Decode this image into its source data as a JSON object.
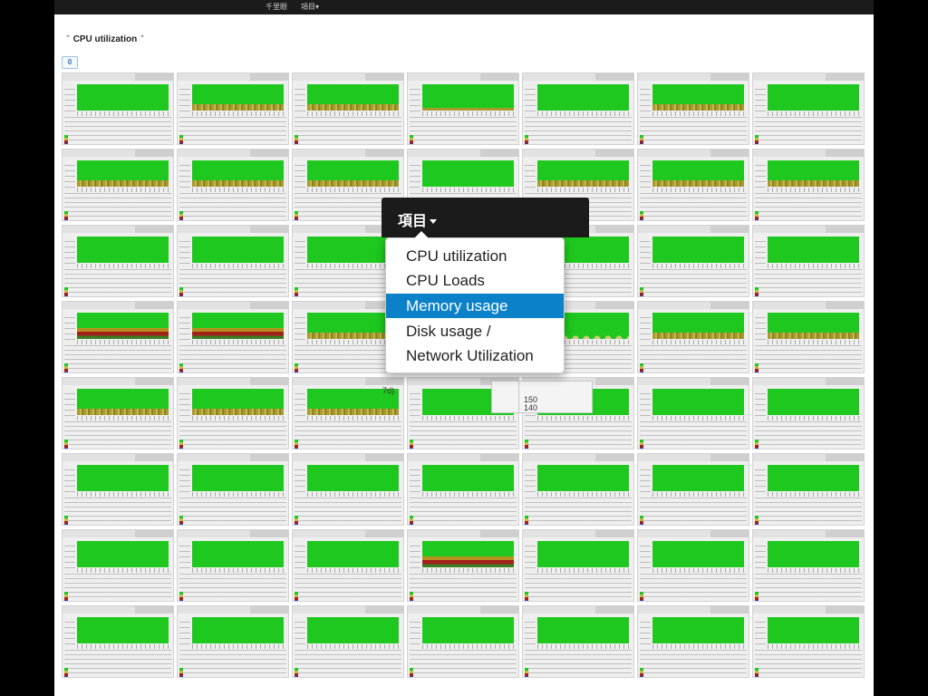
{
  "topbar": {
    "brand": "千里眼",
    "menu": "項目▾"
  },
  "page": {
    "title": "CPU utilization",
    "badge": "0"
  },
  "tile_style": [
    [
      "plain",
      "yellow",
      "yellow",
      "yellow-lo",
      "plain",
      "yellow",
      "plain"
    ],
    [
      "yellow",
      "yellow",
      "yellow",
      "plain",
      "yellow",
      "yellow",
      "yellow"
    ],
    [
      "plain",
      "plain",
      "plain",
      "plain",
      "plain",
      "plain",
      "plain"
    ],
    [
      "red",
      "red",
      "yellow",
      "plain",
      "dots",
      "yellow",
      "yellow"
    ],
    [
      "yellow",
      "yellow",
      "yellow",
      "plain",
      "plain",
      "plain",
      "plain"
    ],
    [
      "plain",
      "plain",
      "plain",
      "plain",
      "plain",
      "plain",
      "plain"
    ],
    [
      "plain",
      "plain",
      "plain",
      "red",
      "plain",
      "plain",
      "plain"
    ],
    [
      "plain",
      "plain",
      "plain",
      "plain",
      "plain",
      "plain",
      "plain"
    ]
  ],
  "overlay": {
    "dropdown_label": "項目",
    "items": [
      {
        "label": "CPU utilization",
        "active": false
      },
      {
        "label": "CPU Loads",
        "active": false
      },
      {
        "label": "Memory usage",
        "active": true
      },
      {
        "label": "Disk usage /",
        "active": false
      },
      {
        "label": "Network Utilization",
        "active": false
      }
    ],
    "background_fragments": {
      "period": "7d)",
      "axis_a": "150",
      "axis_b": "140"
    }
  },
  "colors": {
    "active": "#0a81c9",
    "graph": "#1ec81e",
    "navbar": "#1b1b1b"
  }
}
